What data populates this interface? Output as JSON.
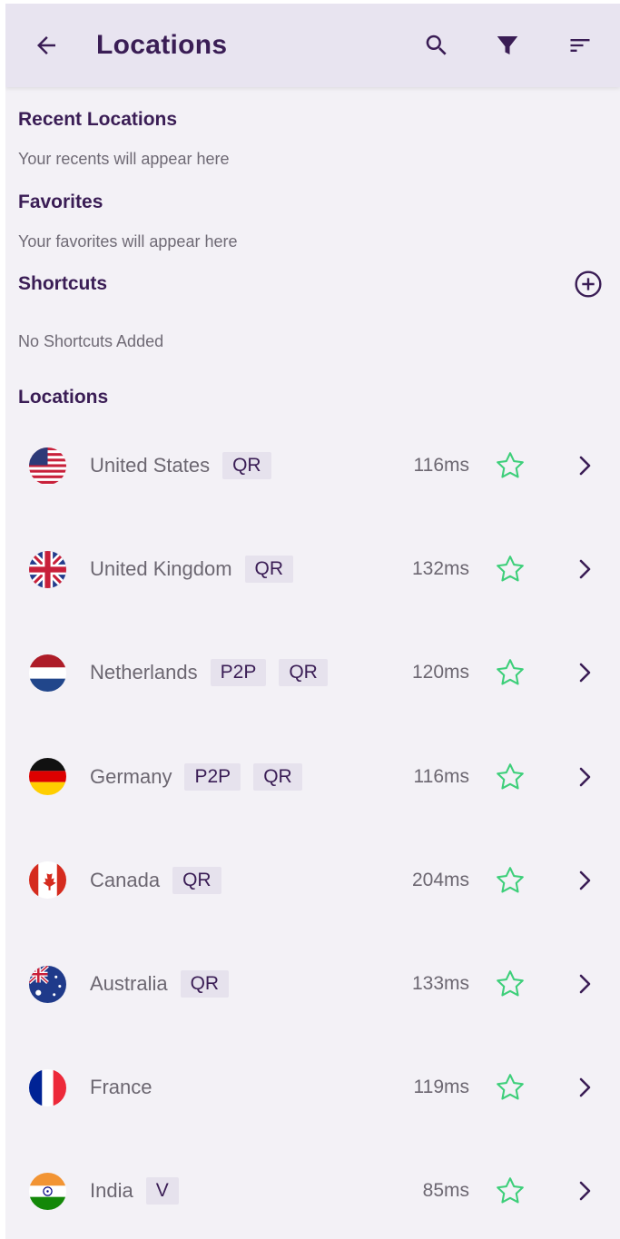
{
  "header": {
    "title": "Locations"
  },
  "sections": {
    "recent_title": "Recent Locations",
    "recent_empty": "Your recents will appear here",
    "favorites_title": "Favorites",
    "favorites_empty": "Your favorites will appear here",
    "shortcuts_title": "Shortcuts",
    "shortcuts_empty": "No Shortcuts Added",
    "locations_title": "Locations"
  },
  "colors": {
    "accent": "#3a1d55",
    "star": "#3ecf7a",
    "tag_bg": "#e6e2ed"
  },
  "locations": [
    {
      "name": "United States",
      "tags": [
        "QR"
      ],
      "latency": "116ms",
      "flag": "us-flag-icon"
    },
    {
      "name": "United Kingdom",
      "tags": [
        "QR"
      ],
      "latency": "132ms",
      "flag": "uk-flag-icon"
    },
    {
      "name": "Netherlands",
      "tags": [
        "P2P",
        "QR"
      ],
      "latency": "120ms",
      "flag": "nl-flag-icon"
    },
    {
      "name": "Germany",
      "tags": [
        "P2P",
        "QR"
      ],
      "latency": "116ms",
      "flag": "de-flag-icon"
    },
    {
      "name": "Canada",
      "tags": [
        "QR"
      ],
      "latency": "204ms",
      "flag": "ca-flag-icon"
    },
    {
      "name": "Australia",
      "tags": [
        "QR"
      ],
      "latency": "133ms",
      "flag": "au-flag-icon"
    },
    {
      "name": "France",
      "tags": [],
      "latency": "119ms",
      "flag": "fr-flag-icon"
    },
    {
      "name": "India",
      "tags": [
        "V"
      ],
      "latency": "85ms",
      "flag": "in-flag-icon"
    }
  ]
}
